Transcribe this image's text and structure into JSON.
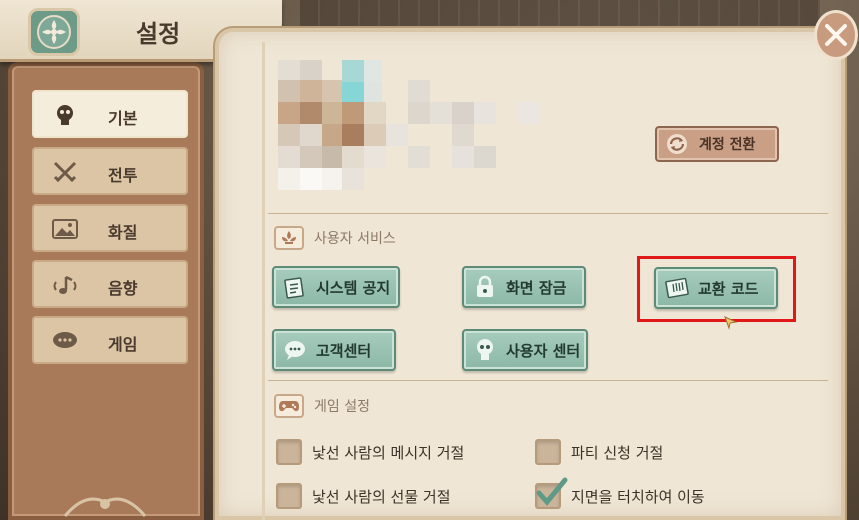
{
  "header": {
    "title": "설정"
  },
  "sidebar": {
    "items": [
      {
        "label": "기본",
        "icon": "character-icon",
        "active": true
      },
      {
        "label": "전투",
        "icon": "crossed-swords-icon",
        "active": false
      },
      {
        "label": "화질",
        "icon": "picture-icon",
        "active": false
      },
      {
        "label": "음향",
        "icon": "sound-icon",
        "active": false
      },
      {
        "label": "게임",
        "icon": "chat-bubble-icon",
        "active": false
      }
    ]
  },
  "account": {
    "switch_label": "계정 전환"
  },
  "user_service": {
    "title": "사용자 서비스",
    "buttons": [
      {
        "label": "시스템 공지",
        "icon": "notice-icon"
      },
      {
        "label": "화면 잠금",
        "icon": "lock-icon"
      },
      {
        "label": "교환 코드",
        "icon": "ticket-icon"
      },
      {
        "label": "고객센터",
        "icon": "chat-icon"
      },
      {
        "label": "사용자 센터",
        "icon": "user-icon"
      }
    ]
  },
  "game_settings": {
    "title": "게임 설정",
    "options": [
      {
        "label": "낯선 사람의 메시지 거절",
        "checked": false
      },
      {
        "label": "파티 신청 거절",
        "checked": false
      },
      {
        "label": "낯선 사람의 선물 거절",
        "checked": false
      },
      {
        "label": "지면을 터치하여 이동",
        "checked": true
      }
    ]
  },
  "colors": {
    "accent_green": "#8cb8a6",
    "highlight_red": "#e01818",
    "panel": "#efe6d5"
  }
}
